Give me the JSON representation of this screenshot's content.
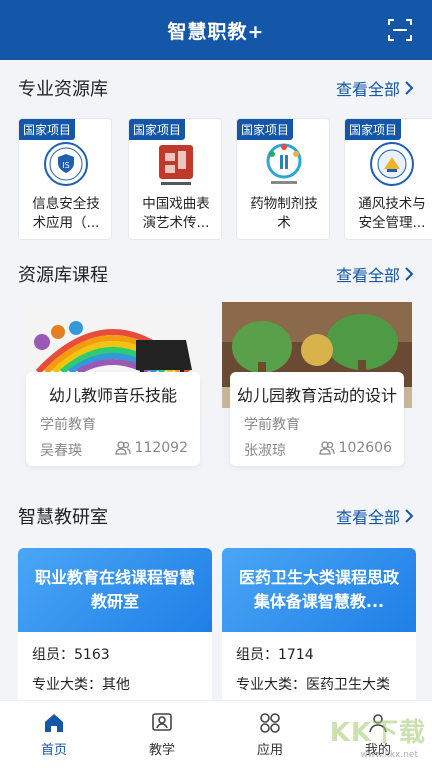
{
  "header": {
    "title": "智慧职教+"
  },
  "sections": {
    "resource_lib": {
      "title": "专业资源库",
      "view_all": "查看全部"
    },
    "courses": {
      "title": "资源库课程",
      "view_all": "查看全部"
    },
    "labs": {
      "title": "智慧教研室",
      "view_all": "查看全部"
    }
  },
  "resources": [
    {
      "tag": "国家项目",
      "name": "信息安全技术应用（...",
      "icon": "shield-seal-icon"
    },
    {
      "tag": "国家项目",
      "name": "中国戏曲表演艺术传...",
      "icon": "red-stamp-icon"
    },
    {
      "tag": "国家项目",
      "name": "药物制剂技术",
      "icon": "pharmacy-logo-icon"
    },
    {
      "tag": "国家项目",
      "name": "通风技术与安全管理...",
      "icon": "school-seal-icon"
    }
  ],
  "courses": [
    {
      "title": "幼儿教师音乐技能",
      "category": "学前教育",
      "teacher": "吴春瑛",
      "views": "112092"
    },
    {
      "title": "幼儿园教育活动的设计",
      "category": "学前教育",
      "teacher": "张淑琼",
      "views": "102606"
    }
  ],
  "labs": [
    {
      "title": "职业教育在线课程智慧教研室",
      "members": "组员：5163",
      "major": "专业大类：其他"
    },
    {
      "title": "医药卫生大类课程思政集体备课智慧教...",
      "members": "组员：1714",
      "major": "专业大类：医药卫生大类"
    }
  ],
  "nav": [
    {
      "label": "首页",
      "icon": "home-icon",
      "active": true
    },
    {
      "label": "教学",
      "icon": "teaching-icon",
      "active": false
    },
    {
      "label": "应用",
      "icon": "apps-icon",
      "active": false
    },
    {
      "label": "我的",
      "icon": "profile-icon",
      "active": false
    }
  ],
  "watermark": {
    "text": "KK下载",
    "url": "www.kkx.net"
  },
  "colors": {
    "primary": "#1456a8",
    "background": "#f3f4f7",
    "lab_banner": "#2f8ef0"
  }
}
